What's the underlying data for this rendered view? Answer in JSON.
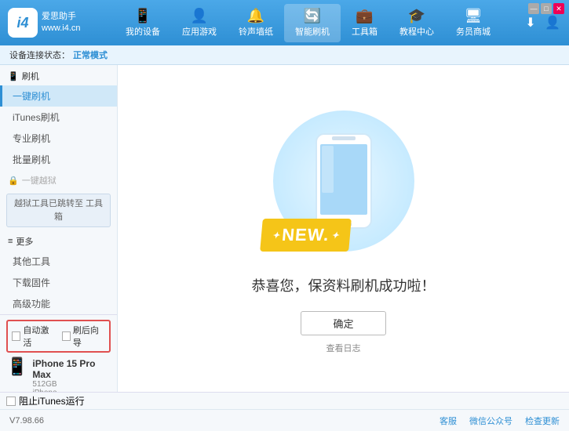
{
  "app": {
    "logo_text_line1": "爱思助手",
    "logo_text_line2": "www.i4.cn",
    "logo_char": "i4"
  },
  "nav": {
    "tabs": [
      {
        "id": "my-device",
        "icon": "📱",
        "label": "我的设备"
      },
      {
        "id": "apps-games",
        "icon": "👤",
        "label": "应用游戏"
      },
      {
        "id": "ringtones",
        "icon": "🔔",
        "label": "铃声墙纸"
      },
      {
        "id": "smart-flash",
        "icon": "🔄",
        "label": "智能刷机",
        "active": true
      },
      {
        "id": "toolbox",
        "icon": "💼",
        "label": "工具箱"
      },
      {
        "id": "tutorial",
        "icon": "🎓",
        "label": "教程中心"
      },
      {
        "id": "service",
        "icon": "🖥",
        "label": "务员商城"
      }
    ]
  },
  "status_bar": {
    "prefix": "设备连接状态：",
    "value": "正常模式"
  },
  "sidebar": {
    "section1_icon": "📱",
    "section1_label": "刷机",
    "items": [
      {
        "id": "one-key-flash",
        "label": "一键刷机",
        "active": true
      },
      {
        "id": "itunes-flash",
        "label": "iTunes刷机"
      },
      {
        "id": "pro-flash",
        "label": "专业刷机"
      },
      {
        "id": "batch-flash",
        "label": "批量刷机"
      }
    ],
    "disabled_label": "一键越狱",
    "disabled_icon": "🔒",
    "info_box": "越狱工具已跳转至\n工具箱",
    "more_label": "更多",
    "more_items": [
      {
        "id": "other-tools",
        "label": "其他工具"
      },
      {
        "id": "download-fw",
        "label": "下载固件"
      },
      {
        "id": "advanced",
        "label": "高级功能"
      }
    ]
  },
  "bottom_controls": {
    "auto_activate": "自动激活",
    "guide_after": "刷后向导"
  },
  "device": {
    "name": "iPhone 15 Pro Max",
    "storage": "512GB",
    "type": "iPhone"
  },
  "content": {
    "success_text": "恭喜您，保资料刷机成功啦！",
    "new_label": "NEW.",
    "confirm_btn": "确定",
    "log_link": "查看日志"
  },
  "footer": {
    "itunes_label": "阻止iTunes运行",
    "version": "V7.98.66",
    "client_label": "客服",
    "wechat_label": "微信公众号",
    "check_update": "检查更新"
  },
  "win_controls": {
    "min": "—",
    "max": "□",
    "close": "✕"
  }
}
